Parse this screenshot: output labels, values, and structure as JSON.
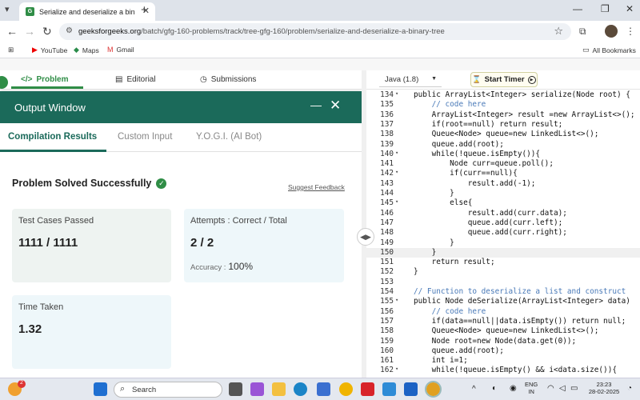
{
  "browser": {
    "tab_title": "Serialize and deserialize a binar",
    "url_host": "geeksforgeeks.org",
    "url_path": "/batch/gfg-160-problems/track/tree-gfg-160/problem/serialize-and-deserialize-a-binary-tree",
    "bookmarks": [
      {
        "label": "YouTube"
      },
      {
        "label": "Maps"
      },
      {
        "label": "Gmail"
      }
    ],
    "all_bookmarks": "All Bookmarks"
  },
  "problem_tabs": {
    "problem": "Problem",
    "editorial": "Editorial",
    "submissions": "Submissions"
  },
  "output_window": {
    "title": "Output Window",
    "tabs": [
      "Compilation Results",
      "Custom Input",
      "Y.O.G.I. (AI Bot)"
    ],
    "status": "Problem Solved Successfully",
    "feedback": "Suggest Feedback",
    "cards": {
      "test_cases_label": "Test Cases Passed",
      "test_cases_value": "1111 / 1111",
      "attempts_label": "Attempts : Correct / Total",
      "attempts_value": "2 / 2",
      "accuracy_label": "Accuracy :",
      "accuracy_value": "100%",
      "time_label": "Time Taken",
      "time_value": "1.32"
    }
  },
  "editor": {
    "language": "Java (1.8)",
    "timer_label": "Start Timer",
    "lines": [
      {
        "n": "134",
        "fold": true,
        "text": "public ArrayList<Integer> serialize(Node root) {"
      },
      {
        "n": "135",
        "text": "    // code here"
      },
      {
        "n": "136",
        "text": "    ArrayList<Integer> result =new ArrayList<>();"
      },
      {
        "n": "137",
        "text": "    if(root==null) return result;"
      },
      {
        "n": "138",
        "text": "    Queue<Node> queue=new LinkedList<>();"
      },
      {
        "n": "139",
        "text": "    queue.add(root);"
      },
      {
        "n": "140",
        "fold": true,
        "text": "    while(!queue.isEmpty()){"
      },
      {
        "n": "141",
        "text": "        Node curr=queue.poll();"
      },
      {
        "n": "142",
        "fold": true,
        "text": "        if(curr==null){"
      },
      {
        "n": "143",
        "text": "            result.add(-1);"
      },
      {
        "n": "144",
        "text": "        }"
      },
      {
        "n": "145",
        "fold": true,
        "text": "        else{"
      },
      {
        "n": "146",
        "text": "            result.add(curr.data);"
      },
      {
        "n": "147",
        "text": "            queue.add(curr.left);"
      },
      {
        "n": "148",
        "text": "            queue.add(curr.right);"
      },
      {
        "n": "149",
        "text": "        }"
      },
      {
        "n": "150",
        "text": "    }",
        "highlight": true
      },
      {
        "n": "151",
        "text": "    return result;"
      },
      {
        "n": "152",
        "text": "}"
      },
      {
        "n": "153",
        "text": ""
      },
      {
        "n": "154",
        "text": "// Function to deserialize a list and construct"
      },
      {
        "n": "155",
        "fold": true,
        "text": "public Node deSerialize(ArrayList<Integer> data)"
      },
      {
        "n": "156",
        "text": "    // code here"
      },
      {
        "n": "157",
        "text": "    if(data==null||data.isEmpty()) return null;"
      },
      {
        "n": "158",
        "text": "    Queue<Node> queue=new LinkedList<>();"
      },
      {
        "n": "159",
        "text": "    Node root=new Node(data.get(0));"
      },
      {
        "n": "160",
        "text": "    queue.add(root);"
      },
      {
        "n": "161",
        "text": "    int i=1;"
      },
      {
        "n": "162",
        "fold": true,
        "text": "    while(!queue.isEmpty() && i<data.size()){"
      }
    ]
  },
  "taskbar": {
    "search_placeholder": "Search",
    "lang": "ENG",
    "region": "IN",
    "time": "23:23",
    "date": "28-02-2025",
    "notification_count": "2"
  }
}
